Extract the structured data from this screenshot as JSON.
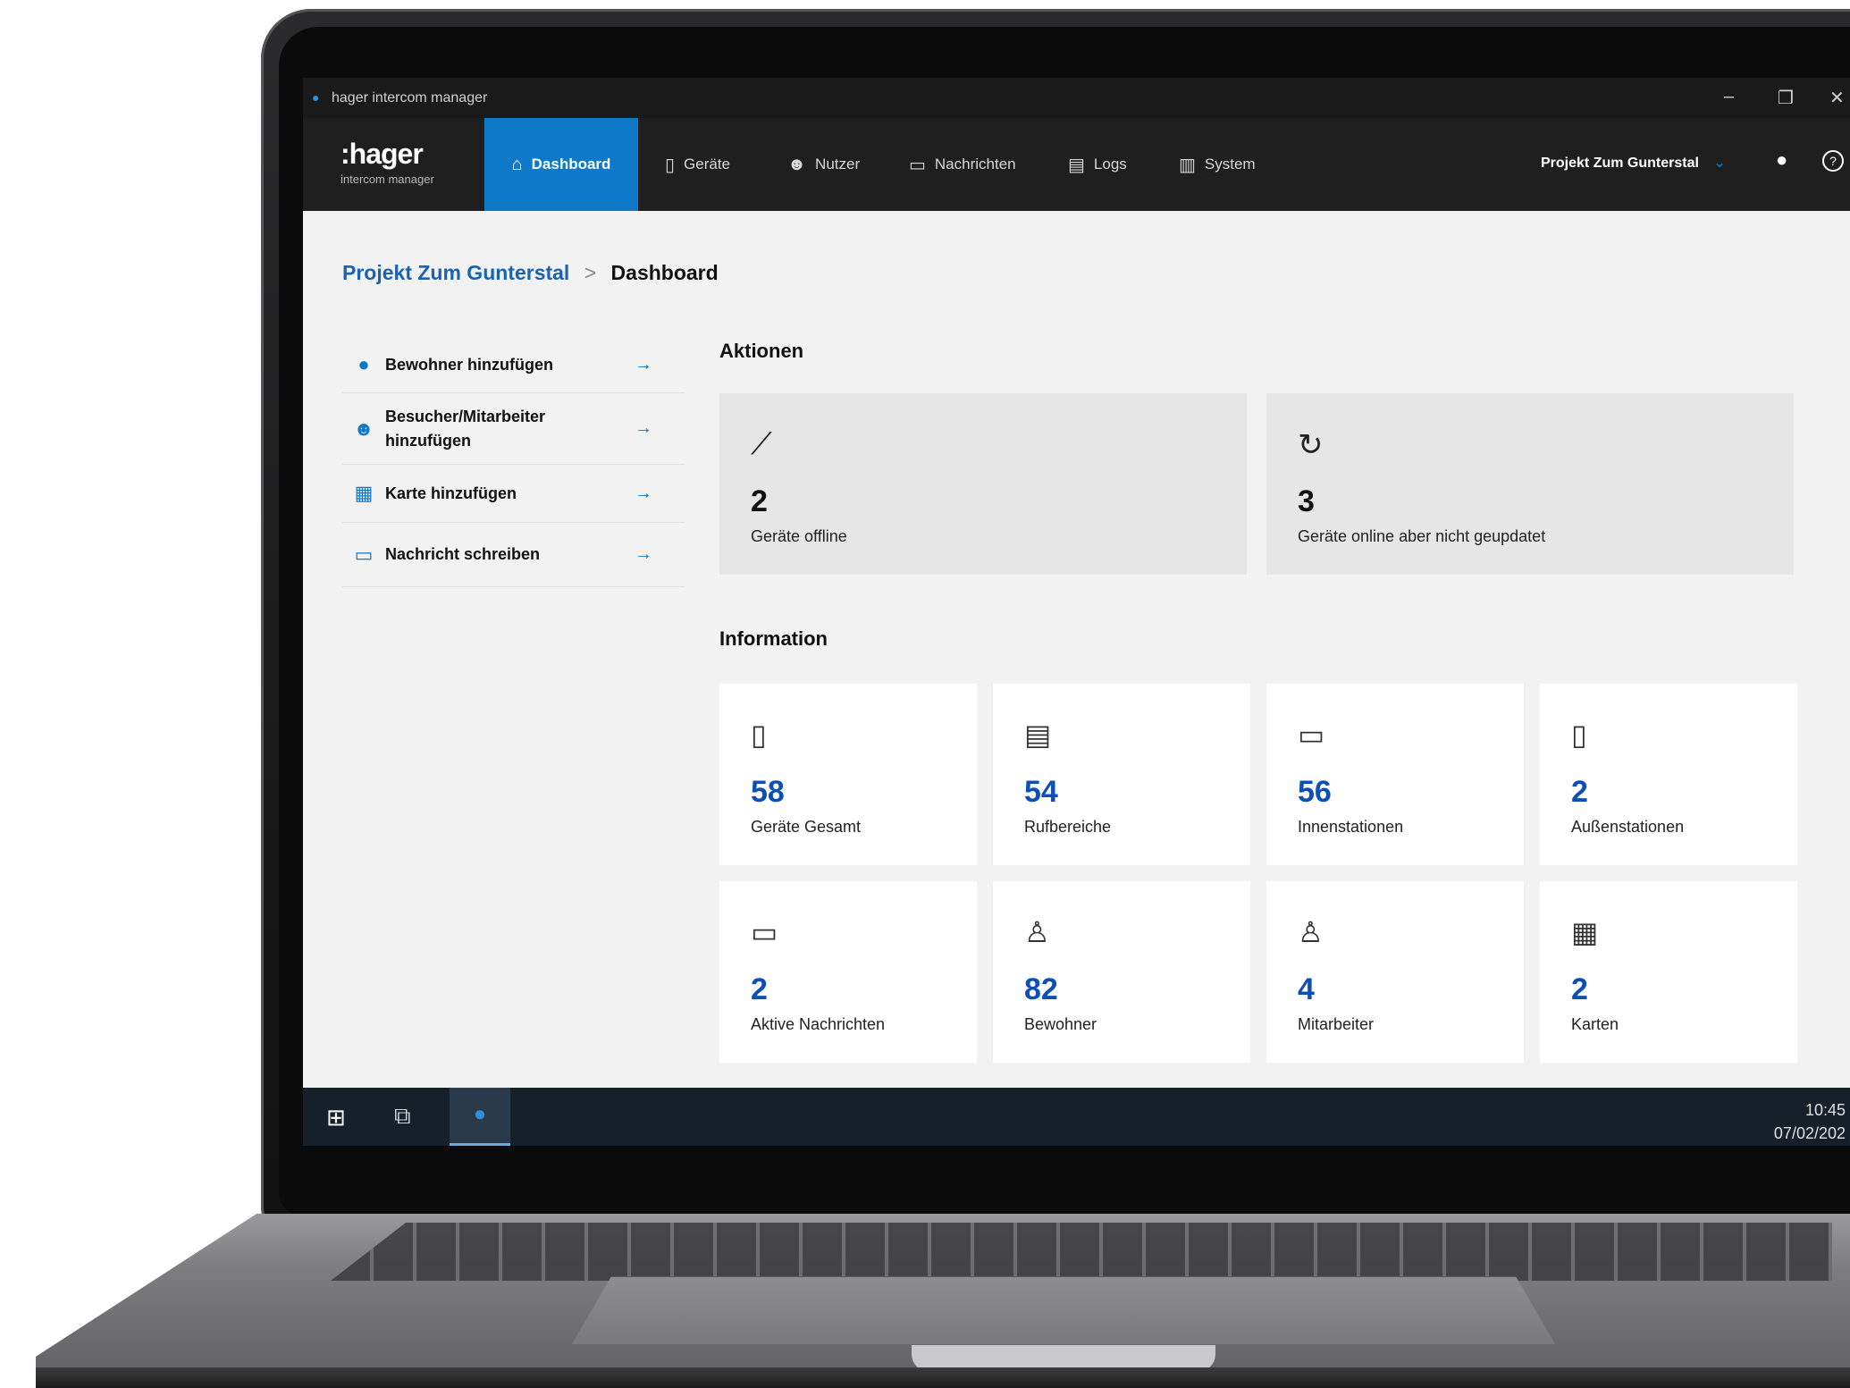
{
  "window": {
    "title": "hager intercom manager",
    "controls": {
      "minimize": "–",
      "maximize": "❐",
      "close": "✕"
    }
  },
  "brand": {
    "name": ":hager",
    "subtitle": "intercom manager"
  },
  "nav": {
    "items": [
      {
        "label": "Dashboard",
        "icon": "home-icon",
        "glyph": "⌂",
        "active": true
      },
      {
        "label": "Geräte",
        "icon": "device-icon",
        "glyph": "▯",
        "active": false
      },
      {
        "label": "Nutzer",
        "icon": "users-icon",
        "glyph": "☻",
        "active": false
      },
      {
        "label": "Nachrichten",
        "icon": "message-icon",
        "glyph": "▭",
        "active": false
      },
      {
        "label": "Logs",
        "icon": "logs-icon",
        "glyph": "▤",
        "active": false
      },
      {
        "label": "System",
        "icon": "system-icon",
        "glyph": "▥",
        "active": false
      }
    ],
    "project": "Projekt Zum Gunterstal",
    "project_chevron": "⌄",
    "user_glyph": "●",
    "help_glyph": "?"
  },
  "breadcrumb": {
    "link": "Projekt Zum Gunterstal",
    "separator": ">",
    "current": "Dashboard"
  },
  "quick_actions": [
    {
      "label": "Bewohner hinzufügen",
      "icon": "person-icon",
      "glyph": "●",
      "arrow": "→"
    },
    {
      "label": "Besucher/Mitarbeiter hinzufügen",
      "icon": "group-icon",
      "glyph": "☻",
      "arrow": "→"
    },
    {
      "label": "Karte hinzufügen",
      "icon": "card-icon",
      "glyph": "▦",
      "arrow": "→"
    },
    {
      "label": "Nachricht schreiben",
      "icon": "chat-icon",
      "glyph": "▭",
      "arrow": "→"
    }
  ],
  "sections": {
    "actions": "Aktionen",
    "information": "Information"
  },
  "action_cards": [
    {
      "value": "2",
      "label": "Geräte offline",
      "icon": "offline-icon",
      "glyph": "⟋"
    },
    {
      "value": "3",
      "label": "Geräte online aber nicht geupdatet",
      "icon": "refresh-icon",
      "glyph": "↻"
    }
  ],
  "info_cards": [
    {
      "value": "58",
      "label": "Geräte Gesamt",
      "icon": "device-wifi-icon",
      "glyph": "▯"
    },
    {
      "value": "54",
      "label": "Rufbereiche",
      "icon": "call-panel-icon",
      "glyph": "▤"
    },
    {
      "value": "56",
      "label": "Innenstationen",
      "icon": "monitor-icon",
      "glyph": "▭"
    },
    {
      "value": "2",
      "label": "Außenstationen",
      "icon": "outdoor-station-icon",
      "glyph": "▯"
    },
    {
      "value": "2",
      "label": "Aktive Nachrichten",
      "icon": "chat-icon",
      "glyph": "▭"
    },
    {
      "value": "82",
      "label": "Bewohner",
      "icon": "person-outline-icon",
      "glyph": "♙"
    },
    {
      "value": "4",
      "label": "Mitarbeiter",
      "icon": "staff-icon",
      "glyph": "♙"
    },
    {
      "value": "2",
      "label": "Karten",
      "icon": "badge-card-icon",
      "glyph": "▦"
    }
  ],
  "taskbar": {
    "start_glyph": "⊞",
    "taskview_glyph": "⧉",
    "app_glyph": "●",
    "time": "10:45",
    "date": "07/02/202"
  },
  "colors": {
    "accent": "#0d79c8",
    "value_blue": "#0d4fb5",
    "nav_bg": "#1f1f1f",
    "page_bg": "#f2f2f2"
  }
}
